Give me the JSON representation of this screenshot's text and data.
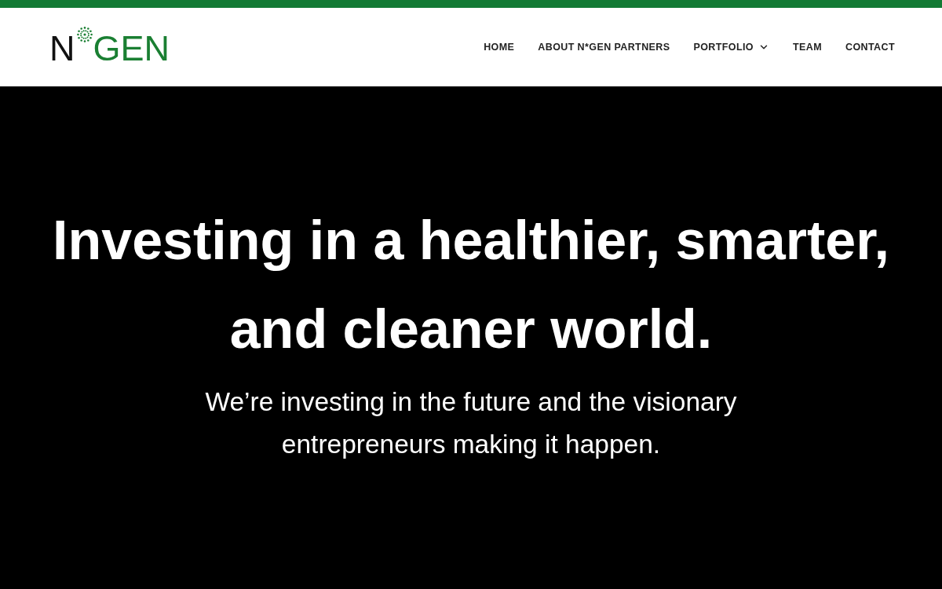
{
  "logo": {
    "text_before_mark": "N",
    "text_after_mark": "GEN"
  },
  "nav": {
    "items": [
      {
        "label": "HOME",
        "has_dropdown": false
      },
      {
        "label": "ABOUT N*GEN PARTNERS",
        "has_dropdown": false
      },
      {
        "label": "PORTFOLIO",
        "has_dropdown": true
      },
      {
        "label": "TEAM",
        "has_dropdown": false
      },
      {
        "label": "CONTACT",
        "has_dropdown": false
      }
    ]
  },
  "hero": {
    "headline": "Investing in a healthier, smarter, and cleaner world.",
    "subheading": "We’re investing in the future and the visionary entrepreneurs making it happen."
  }
}
